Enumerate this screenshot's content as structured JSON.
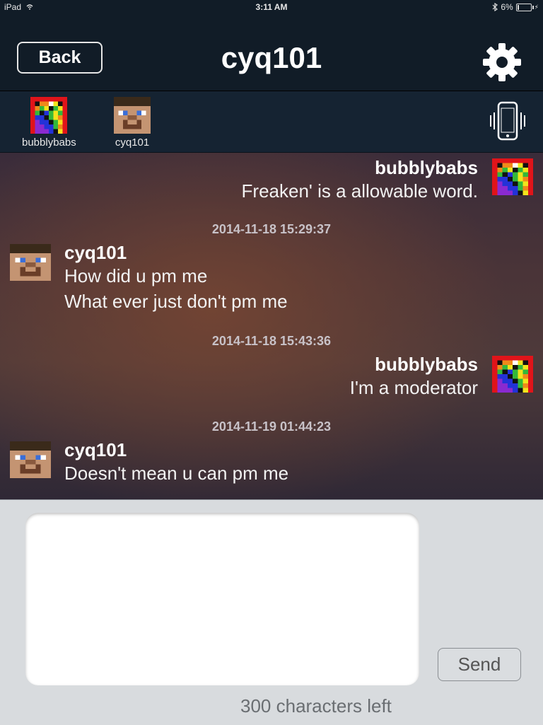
{
  "status_bar": {
    "device": "iPad",
    "time": "3:11 AM",
    "battery": "6%"
  },
  "nav": {
    "back_label": "Back",
    "title": "cyq101",
    "settings_icon": "gear-icon"
  },
  "members": [
    {
      "name": "bubblybabs",
      "avatar": "rainbow-avatar"
    },
    {
      "name": "cyq101",
      "avatar": "steve-avatar"
    }
  ],
  "vibrate_icon": "phone-vibrate-icon",
  "messages": [
    {
      "sender": "bubblybabs",
      "side": "right",
      "lines": [
        "Freaken' is a allowable word."
      ]
    },
    {
      "timestamp": "2014-11-18 15:29:37"
    },
    {
      "sender": "cyq101",
      "side": "left",
      "lines": [
        "How did u pm me",
        "What ever just don't pm me"
      ]
    },
    {
      "timestamp": "2014-11-18 15:43:36"
    },
    {
      "sender": "bubblybabs",
      "side": "right",
      "lines": [
        "I'm a moderator"
      ]
    },
    {
      "timestamp": "2014-11-19 01:44:23"
    },
    {
      "sender": "cyq101",
      "side": "left",
      "lines": [
        "Doesn't mean u can pm me"
      ]
    }
  ],
  "composer": {
    "value": "",
    "send_label": "Send",
    "counter": "300 characters left"
  },
  "colors": {
    "header_bg": "#111c27",
    "member_bar_bg": "#152332",
    "input_area_bg": "#d8dbde"
  }
}
